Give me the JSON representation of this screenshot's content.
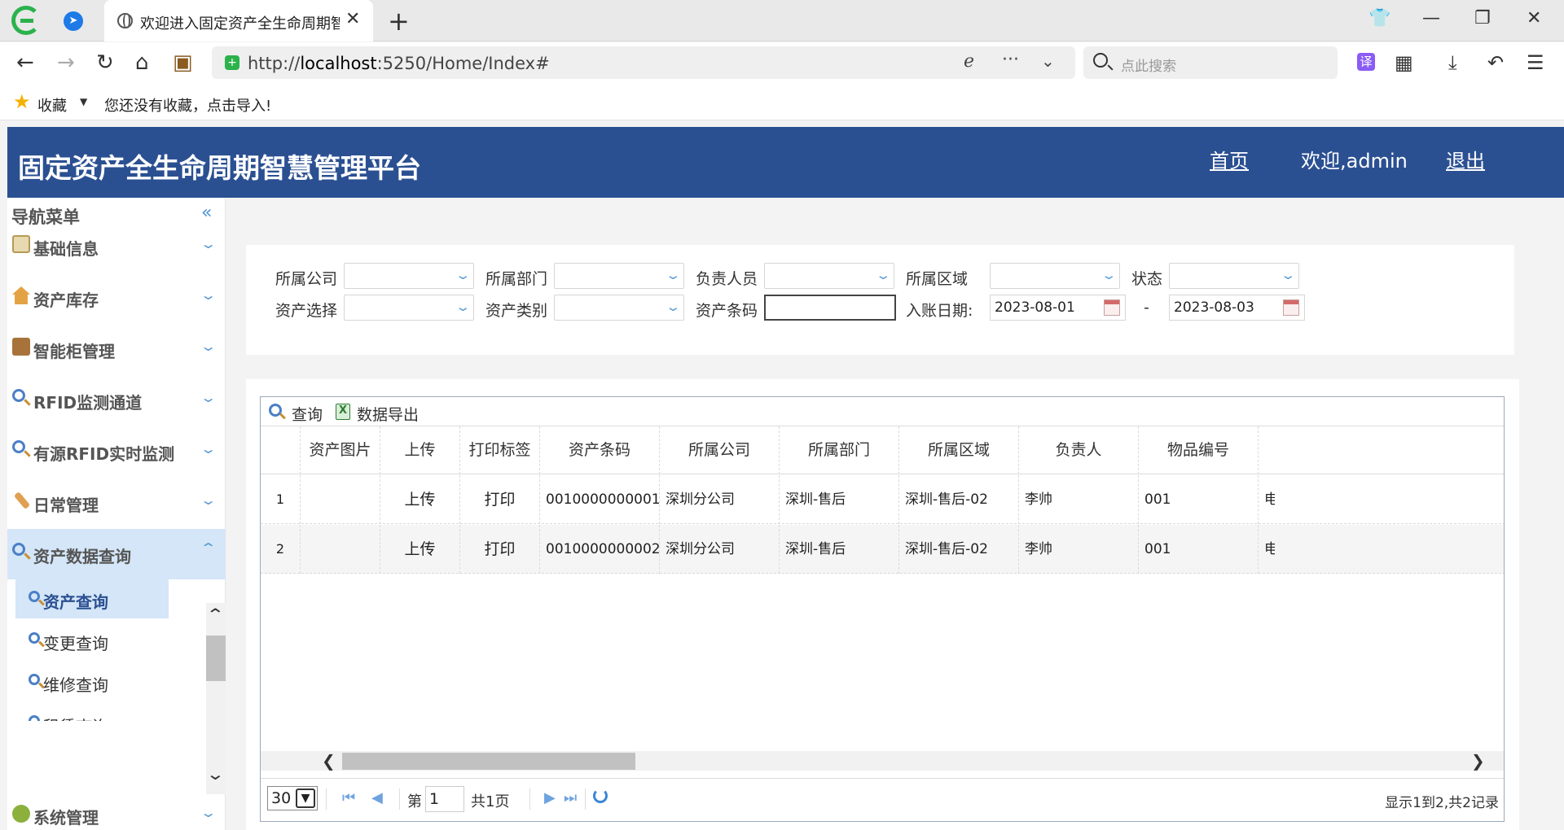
{
  "browser": {
    "tab_title": "欢迎进入固定资产全生命周期智慧管理平台",
    "url_scheme": "http://",
    "url_host": "localhost",
    "url_rest": ":5250/Home/Index#",
    "search_placeholder": "点此搜索",
    "translate_label": "译",
    "bookmarks_label": "收藏",
    "bookmarks_hint": "您还没有收藏，点击导入!"
  },
  "header": {
    "title": "固定资产全生命周期智慧管理平台",
    "home": "首页",
    "welcome": "欢迎,admin",
    "logout": "退出"
  },
  "sidebar": {
    "title": "导航菜单",
    "items": [
      {
        "label": "基础信息",
        "icon": "note-icon"
      },
      {
        "label": "资产库存",
        "icon": "house-icon"
      },
      {
        "label": "智能柜管理",
        "icon": "cabinet-icon"
      },
      {
        "label": "RFID监测通道",
        "icon": "search-icon"
      },
      {
        "label": "有源RFID实时监测",
        "icon": "search-icon"
      },
      {
        "label": "日常管理",
        "icon": "wrench-icon"
      },
      {
        "label": "资产数据查询",
        "icon": "search-icon"
      }
    ],
    "sub_items": [
      "资产查询",
      "变更查询",
      "维修查询",
      "租赁查询"
    ],
    "bottom_item": "系统管理"
  },
  "filters": {
    "company_label": "所属公司",
    "dept_label": "所属部门",
    "person_label": "负责人员",
    "area_label": "所属区域",
    "status_label": "状态",
    "asset_select_label": "资产选择",
    "category_label": "资产类别",
    "barcode_label": "资产条码",
    "date_label": "入账日期:",
    "date_from": "2023-08-01",
    "date_sep": "-",
    "date_to": "2023-08-03"
  },
  "grid": {
    "query_label": "查询",
    "export_label": "数据导出",
    "columns": [
      "资产图片",
      "上传",
      "打印标签",
      "资产条码",
      "所属公司",
      "所属部门",
      "所属区域",
      "负责人",
      "物品编号"
    ],
    "rows": [
      {
        "num": "1",
        "upload": "上传",
        "print": "打印",
        "barcode": "0010000000001",
        "company": "深圳分公司",
        "dept": "深圳-售后",
        "area": "深圳-售后-02",
        "owner": "李帅",
        "item_no": "001",
        "extra": "电脑"
      },
      {
        "num": "2",
        "upload": "上传",
        "print": "打印",
        "barcode": "0010000000002",
        "company": "深圳分公司",
        "dept": "深圳-售后",
        "area": "深圳-售后-02",
        "owner": "李帅",
        "item_no": "001",
        "extra": "电脑"
      }
    ],
    "pager": {
      "page_size": "30",
      "page_prefix": "第",
      "page_value": "1",
      "page_suffix": "共1页",
      "info": "显示1到2,共2记录"
    }
  }
}
